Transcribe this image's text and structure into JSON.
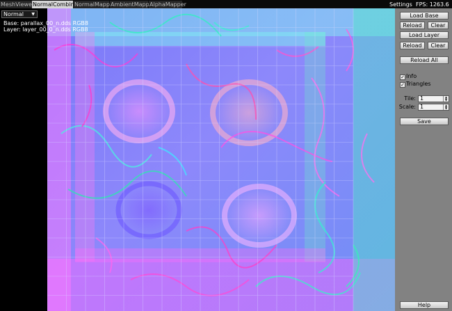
{
  "tabs": [
    {
      "label": "MeshViewer",
      "active": false
    },
    {
      "label": "NormalCombiner",
      "active": true
    },
    {
      "label": "NormalMapper",
      "active": false
    },
    {
      "label": "AmbientMapper",
      "active": false
    },
    {
      "label": "AlphaMapper",
      "active": false
    }
  ],
  "topbar": {
    "settings_label": "Settings",
    "fps_text": "FPS: 1263.6"
  },
  "left_panel": {
    "mode_select": {
      "value": "Normal",
      "icon": "dropdown-arrow"
    },
    "info_base": "Base: parallax_00_n.dds RGB8",
    "info_layer": "Layer: layer_00_0_n.dds RGB8"
  },
  "right_panel": {
    "load_base": "Load Base",
    "base_reload": "Reload",
    "base_clear": "Clear",
    "load_layer": "Load Layer",
    "layer_reload": "Reload",
    "layer_clear": "Clear",
    "reload_all": "Reload All",
    "info_checkbox": {
      "label": "Info",
      "checked": true
    },
    "triangles_checkbox": {
      "label": "Triangles",
      "checked": true
    },
    "tile": {
      "label": "Tile:",
      "value": "1"
    },
    "scale": {
      "label": "Scale:",
      "value": "1"
    },
    "save": "Save",
    "help": "Help"
  },
  "colors": {
    "panel": "#828282",
    "active_tab": "#d6d6d6",
    "normal_map_base": "#8080ff"
  }
}
